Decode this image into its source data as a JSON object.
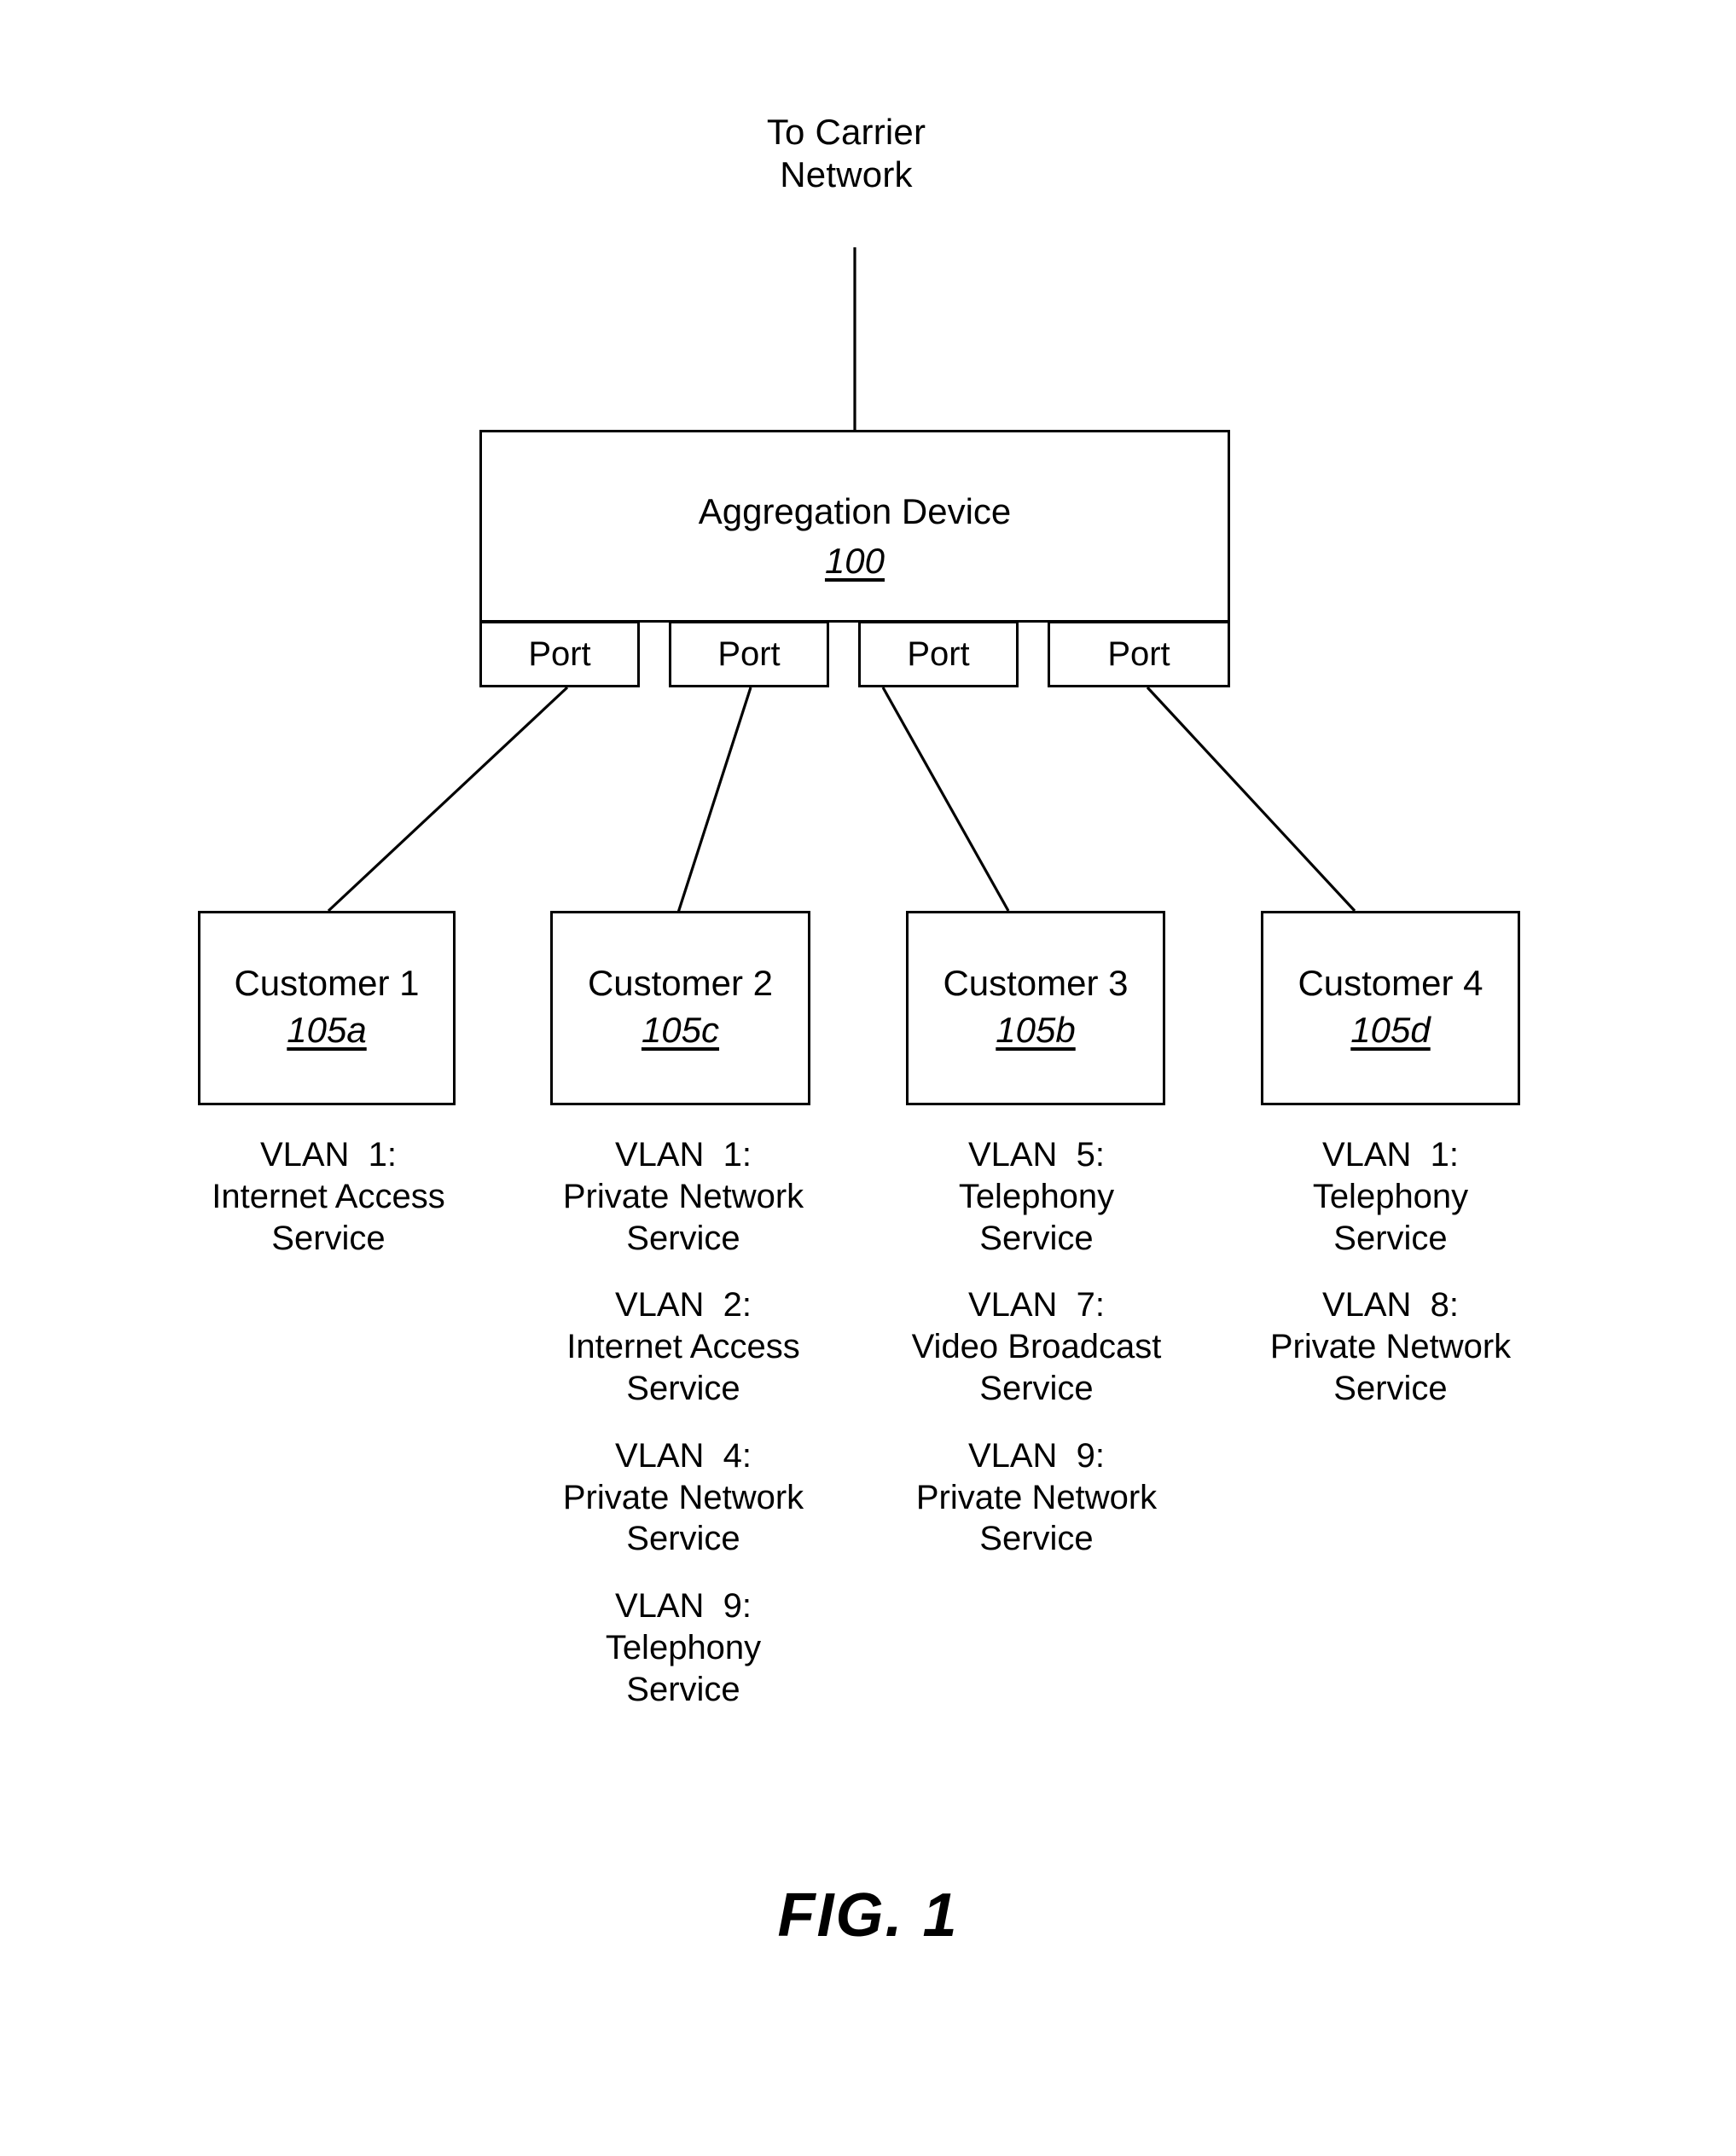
{
  "figure": {
    "caption": "FIG. 1",
    "carrier_label": "To Carrier\nNetwork"
  },
  "aggregation_device": {
    "title": "Aggregation Device",
    "reference_numeral": "100",
    "ports": [
      {
        "label": "Port"
      },
      {
        "label": "Port"
      },
      {
        "label": "Port"
      },
      {
        "label": "Port"
      }
    ]
  },
  "customers": [
    {
      "name": "Customer 1",
      "reference_numeral": "105a",
      "vlans": [
        {
          "id": "VLAN  1:",
          "service": "Internet Access\nService"
        }
      ]
    },
    {
      "name": "Customer 2",
      "reference_numeral": "105c",
      "vlans": [
        {
          "id": "VLAN  1:",
          "service": "Private Network\nService"
        },
        {
          "id": "VLAN  2:",
          "service": "Internet Access\nService"
        },
        {
          "id": "VLAN  4:",
          "service": "Private Network\nService"
        },
        {
          "id": "VLAN  9:",
          "service": "Telephony\nService"
        }
      ]
    },
    {
      "name": "Customer 3",
      "reference_numeral": "105b",
      "vlans": [
        {
          "id": "VLAN  5:",
          "service": "Telephony\nService"
        },
        {
          "id": "VLAN  7:",
          "service": "Video Broadcast\nService"
        },
        {
          "id": "VLAN  9:",
          "service": "Private Network\nService"
        }
      ]
    },
    {
      "name": "Customer 4",
      "reference_numeral": "105d",
      "vlans": [
        {
          "id": "VLAN  1:",
          "service": "Telephony\nService"
        },
        {
          "id": "VLAN  8:",
          "service": "Private Network\nService"
        }
      ]
    }
  ],
  "colors": {
    "line": "#000000",
    "background": "#ffffff"
  }
}
